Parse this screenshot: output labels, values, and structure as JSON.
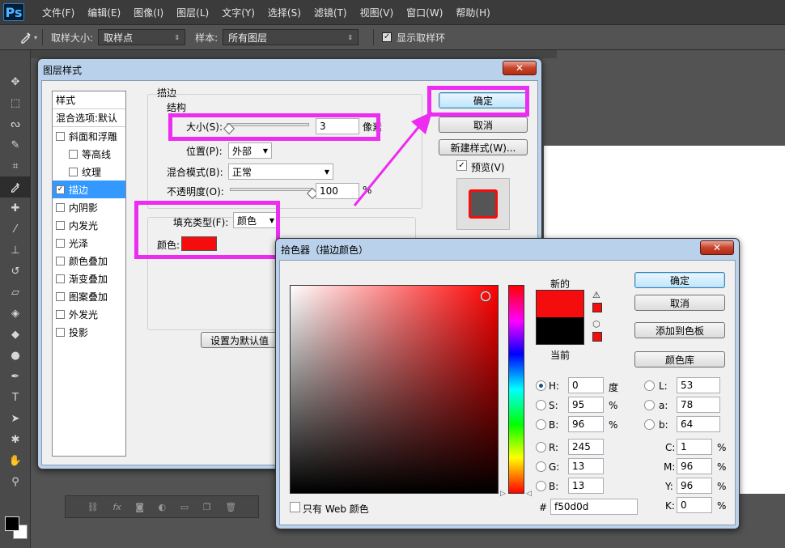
{
  "menubar": {
    "logo": "Ps",
    "items": [
      "文件(F)",
      "编辑(E)",
      "图像(I)",
      "图层(L)",
      "文字(Y)",
      "选择(S)",
      "滤镜(T)",
      "视图(V)",
      "窗口(W)",
      "帮助(H)"
    ]
  },
  "options": {
    "sample_size_label": "取样大小:",
    "sample_size_value": "取样点",
    "sample_label": "样本:",
    "sample_value": "所有图层",
    "show_ring_label": "显示取样环"
  },
  "layer_style": {
    "title": "图层样式",
    "styles_header": "样式",
    "blending_default": "混合选项:默认",
    "items": [
      {
        "label": "斜面和浮雕",
        "checked": false,
        "indent": false
      },
      {
        "label": "等高线",
        "checked": false,
        "indent": true
      },
      {
        "label": "纹理",
        "checked": false,
        "indent": true
      },
      {
        "label": "描边",
        "checked": true,
        "indent": false,
        "selected": true
      },
      {
        "label": "内阴影",
        "checked": false,
        "indent": false
      },
      {
        "label": "内发光",
        "checked": false,
        "indent": false
      },
      {
        "label": "光泽",
        "checked": false,
        "indent": false
      },
      {
        "label": "颜色叠加",
        "checked": false,
        "indent": false
      },
      {
        "label": "渐变叠加",
        "checked": false,
        "indent": false
      },
      {
        "label": "图案叠加",
        "checked": false,
        "indent": false
      },
      {
        "label": "外发光",
        "checked": false,
        "indent": false
      },
      {
        "label": "投影",
        "checked": false,
        "indent": false
      }
    ],
    "section_title": "描边",
    "structure_title": "结构",
    "size_label": "大小(S):",
    "size_value": "3",
    "size_unit": "像素",
    "size_slider_fraction": 0.03,
    "position_label": "位置(P):",
    "position_value": "外部",
    "blend_mode_label": "混合模式(B):",
    "blend_mode_value": "正常",
    "opacity_label": "不透明度(O):",
    "opacity_value": "100",
    "opacity_unit": "%",
    "opacity_fraction": 1.0,
    "fill_type_label": "填充类型(F):",
    "fill_type_value": "颜色",
    "color_label": "颜色:",
    "stroke_color": "#f50d0d",
    "set_default_label": "设置为默认值",
    "ok_label": "确定",
    "cancel_label": "取消",
    "new_style_label": "新建样式(W)...",
    "preview_label": "预览(V)",
    "preview_checked": true
  },
  "color_picker": {
    "title": "拾色器（描边颜色）",
    "new_label": "新的",
    "current_label": "当前",
    "new_color": "#f50d0d",
    "current_color": "#000000",
    "ok_label": "确定",
    "cancel_label": "取消",
    "add_swatch_label": "添加到色板",
    "color_libraries_label": "颜色库",
    "web_only_label": "只有 Web 颜色",
    "hsb": {
      "H": "0",
      "S": "95",
      "B": "96",
      "h_unit": "度",
      "s_unit": "%",
      "b_unit": "%"
    },
    "rgb": {
      "R": "245",
      "G": "13",
      "B": "13"
    },
    "lab": {
      "L": "53",
      "a": "78",
      "b": "64"
    },
    "cmyk": {
      "C": "1",
      "M": "96",
      "Y": "96",
      "K": "0",
      "unit": "%"
    },
    "hex_label": "#",
    "hex": "f50d0d",
    "labels": {
      "H": "H:",
      "S": "S:",
      "B": "B:",
      "R": "R:",
      "G": "G:",
      "B2": "B:",
      "L": "L:",
      "a": "a:",
      "b": "b:",
      "C": "C:",
      "M": "M:",
      "Y": "Y:",
      "K": "K:"
    }
  },
  "colors": {
    "highlight": "#ec2cf0",
    "accent": "#3399ff",
    "stroke": "#f50d0d"
  },
  "panel_strip_icons": [
    "link-icon",
    "fx-icon",
    "mask-icon",
    "adjustment-icon",
    "folder-icon",
    "new-layer-icon",
    "trash-icon"
  ]
}
